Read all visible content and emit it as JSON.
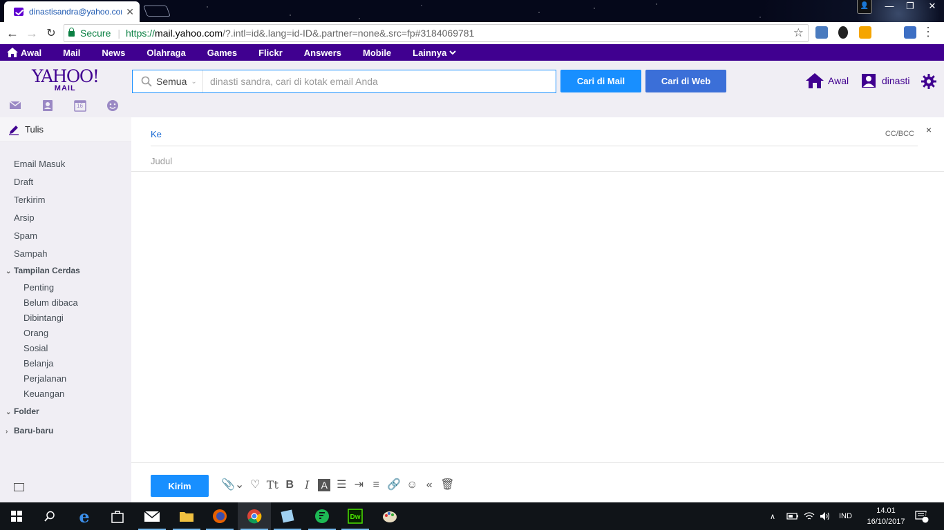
{
  "browser": {
    "tab_title": "dinastisandra@yahoo.com",
    "secure_label": "Secure",
    "url_scheme": "https://",
    "url_host": "mail.yahoo.com",
    "url_rest": "/?.intl=id&.lang=id-ID&.partner=none&.src=fp#3184069781"
  },
  "topnav": {
    "items": [
      "Awal",
      "Mail",
      "News",
      "Olahraga",
      "Games",
      "Flickr",
      "Answers",
      "Mobile",
      "Lainnya"
    ]
  },
  "header": {
    "logo_text": "YAHOO!",
    "logo_sub": "MAIL",
    "search_scope": "Semua",
    "search_placeholder": "dinasti sandra, cari di kotak email Anda",
    "btn_search_mail": "Cari di Mail",
    "btn_search_web": "Cari di Web",
    "home_label": "Awal",
    "user_label": "dinasti",
    "calendar_day": "16"
  },
  "sidebar": {
    "compose_label": "Tulis",
    "folders": [
      "Email Masuk",
      "Draft",
      "Terkirim",
      "Arsip",
      "Spam",
      "Sampah"
    ],
    "smart_views_label": "Tampilan Cerdas",
    "smart_views": [
      "Penting",
      "Belum dibaca",
      "Dibintangi",
      "Orang",
      "Sosial",
      "Belanja",
      "Perjalanan",
      "Keuangan"
    ],
    "folder_label": "Folder",
    "recent_label": "Baru-baru"
  },
  "compose": {
    "to_label": "Ke",
    "ccbcc_label": "CC/BCC",
    "close_label": "×",
    "subject_placeholder": "Judul",
    "send_label": "Kirim"
  },
  "taskbar": {
    "lang": "IND",
    "time": "14.01",
    "date": "16/10/2017",
    "notif_count": "1"
  },
  "colors": {
    "yahoo_purple": "#400090",
    "primary_blue": "#188fff",
    "sidebar_bg": "#f0eef4"
  }
}
